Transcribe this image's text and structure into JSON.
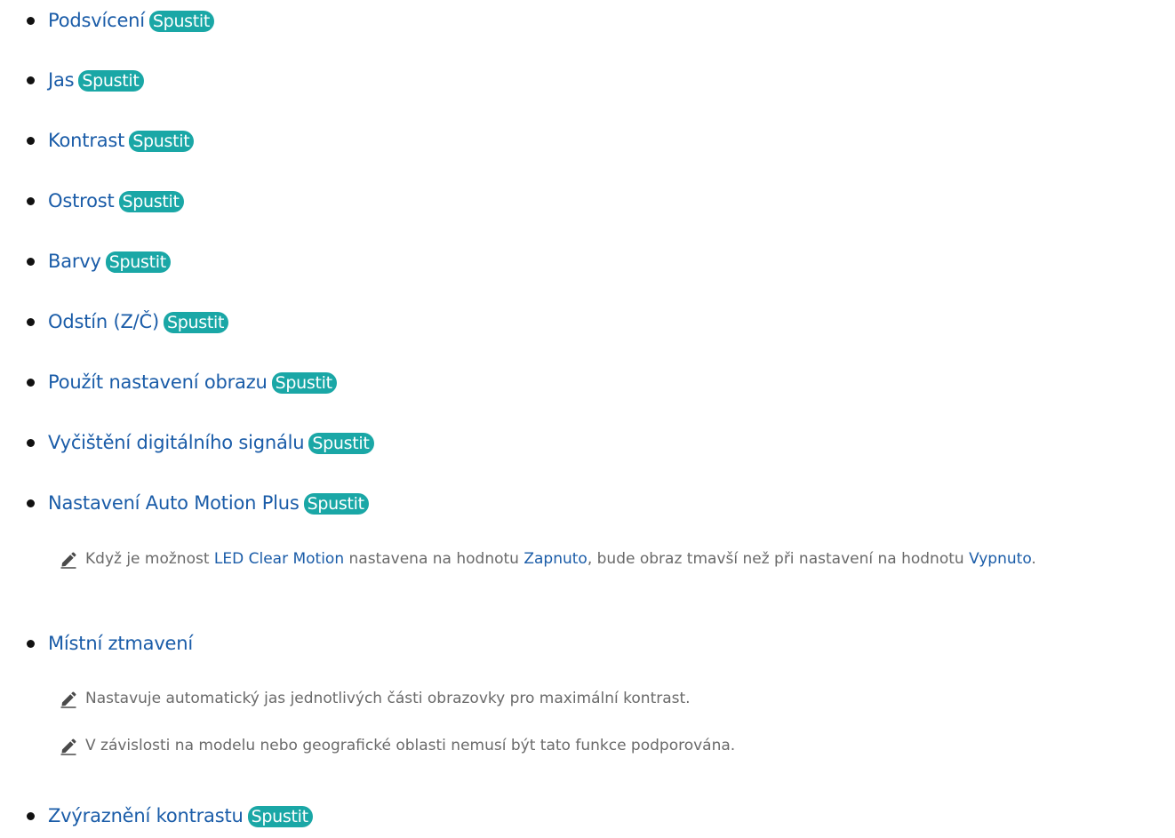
{
  "badge_label": "Spustit",
  "colors": {
    "link": "#1a5ca8",
    "badge": "#1aa7a6",
    "note_text": "#6a6a6a"
  },
  "items": [
    {
      "label": "Podsvícení"
    },
    {
      "label": "Jas"
    },
    {
      "label": "Kontrast"
    },
    {
      "label": "Ostrost"
    },
    {
      "label": "Barvy"
    },
    {
      "label": "Odstín (Z/Č)"
    },
    {
      "label": "Použít nastavení obrazu"
    },
    {
      "label": "Vyčištění digitálního signálu"
    },
    {
      "label": "Nastavení Auto Motion Plus"
    },
    {
      "label": "Místní ztmavení"
    },
    {
      "label": "Zvýraznění kontrastu"
    }
  ],
  "notes": {
    "auto_motion": {
      "t1": "Když je možnost ",
      "em1": "LED Clear Motion",
      "t2": " nastavena na hodnotu ",
      "em2": "Zapnuto",
      "t3": ", bude obraz tmavší než při nastavení na hodnotu ",
      "em3": "Vypnuto",
      "t4": "."
    },
    "local_dimming_1": "Nastavuje automatický jas jednotlivých části obrazovky pro maximální kontrast.",
    "local_dimming_2": "V závislosti na modelu nebo geografické oblasti nemusí být tato funkce podporována."
  }
}
